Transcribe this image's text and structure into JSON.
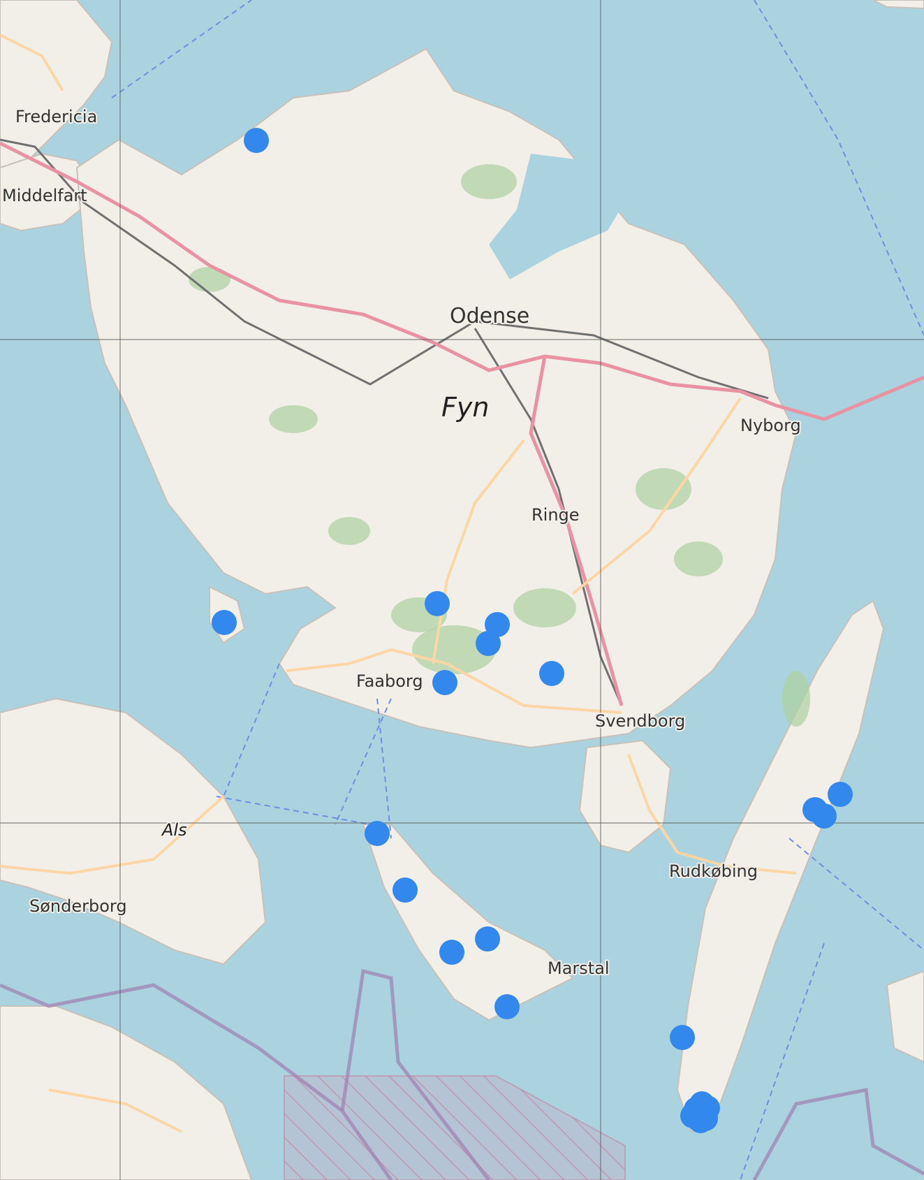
{
  "places": [
    {
      "id": "fredericia",
      "label": "Fredericia"
    },
    {
      "id": "middelfart",
      "label": "Middelfart"
    },
    {
      "id": "odense",
      "label": "Odense"
    },
    {
      "id": "fyn",
      "label": "Fyn"
    },
    {
      "id": "nyborg",
      "label": "Nyborg"
    },
    {
      "id": "ringe",
      "label": "Ringe"
    },
    {
      "id": "faaborg",
      "label": "Faaborg"
    },
    {
      "id": "svendborg",
      "label": "Svendborg"
    },
    {
      "id": "als",
      "label": "Als"
    },
    {
      "id": "sonderborg",
      "label": "Sønderborg"
    },
    {
      "id": "rudkobing",
      "label": "Rudkøbing"
    },
    {
      "id": "marstal",
      "label": "Marstal"
    }
  ],
  "marker_count": 22,
  "colors": {
    "water": "#aad3df",
    "land": "#f2efe9",
    "forest": "#add19e",
    "motorway": "#e892a2",
    "primary_road": "#fcd6a4",
    "railway": "#707070",
    "boundary": "#9e7fb0",
    "ferry": "#6f8ee0",
    "marker": "#3388ee"
  }
}
